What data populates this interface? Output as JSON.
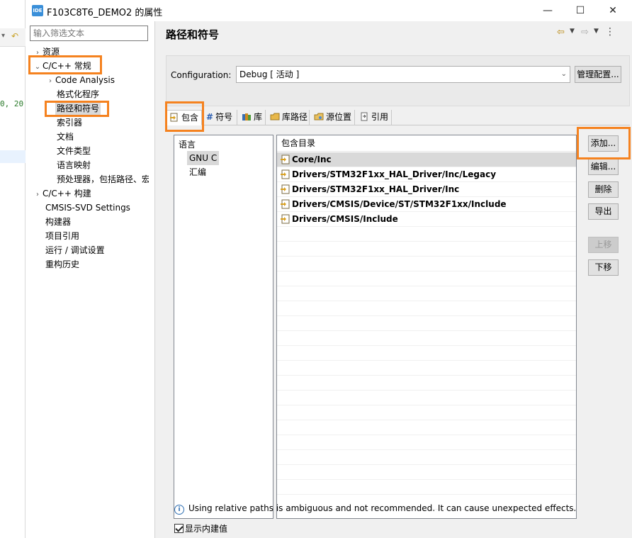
{
  "window": {
    "app_icon": "IDE",
    "title": "F103C8T6_DEMO2 的属性",
    "minimize": "—",
    "maximize": "☐",
    "close": "✕"
  },
  "editor": {
    "code_fragment": "0, 20"
  },
  "tree": {
    "filter_placeholder": "输入筛选文本",
    "nodes": [
      {
        "label": "资源",
        "level": 0,
        "arrow": "›"
      },
      {
        "label": "C/C++ 常规",
        "level": 0,
        "arrow": "⌄"
      },
      {
        "label": "Code Analysis",
        "level": 1,
        "arrow": "›"
      },
      {
        "label": "格式化程序",
        "level": 1,
        "arrow": ""
      },
      {
        "label": "路径和符号",
        "level": 1,
        "arrow": ""
      },
      {
        "label": "索引器",
        "level": 1,
        "arrow": ""
      },
      {
        "label": "文档",
        "level": 1,
        "arrow": ""
      },
      {
        "label": "文件类型",
        "level": 1,
        "arrow": ""
      },
      {
        "label": "语言映射",
        "level": 1,
        "arrow": ""
      },
      {
        "label": "预处理器，包括路径、宏",
        "level": 1,
        "arrow": ""
      },
      {
        "label": "C/C++ 构建",
        "level": 0,
        "arrow": "›"
      },
      {
        "label": "CMSIS-SVD Settings",
        "level": 0,
        "arrow": ""
      },
      {
        "label": "构建器",
        "level": 0,
        "arrow": ""
      },
      {
        "label": "项目引用",
        "level": 0,
        "arrow": ""
      },
      {
        "label": "运行 / 调试设置",
        "level": 0,
        "arrow": ""
      },
      {
        "label": "重构历史",
        "level": 0,
        "arrow": ""
      }
    ]
  },
  "page": {
    "title": "路径和符号",
    "config_label": "Configuration:",
    "config_value": "Debug  [ 活动 ]",
    "manage_button": "管理配置..."
  },
  "tabs": [
    {
      "label": "包含"
    },
    {
      "label": "符号"
    },
    {
      "label": "库"
    },
    {
      "label": "库路径"
    },
    {
      "label": "源位置"
    },
    {
      "label": "引用"
    }
  ],
  "languages": {
    "header": "语言",
    "items": [
      "GNU C",
      "汇编"
    ]
  },
  "includes": {
    "header": "包含目录",
    "items": [
      "Core/Inc",
      "Drivers/STM32F1xx_HAL_Driver/Inc/Legacy",
      "Drivers/STM32F1xx_HAL_Driver/Inc",
      "Drivers/CMSIS/Device/ST/STM32F1xx/Include",
      "Drivers/CMSIS/Include"
    ]
  },
  "buttons": {
    "add": "添加...",
    "edit": "编辑...",
    "delete": "删除",
    "export": "导出",
    "move_up": "上移",
    "move_down": "下移"
  },
  "info": {
    "icon": "i",
    "text": "Using relative paths is ambiguous and not recommended. It can cause unexpected effects."
  },
  "builtin_label": "显示内建值"
}
